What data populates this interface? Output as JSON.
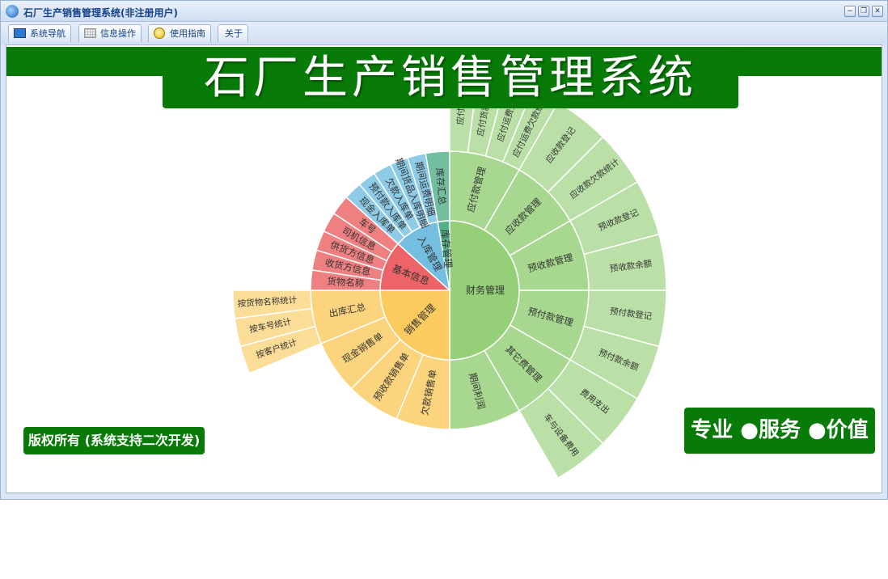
{
  "window": {
    "title": "石厂生产销售管理系统(非注册用户)",
    "controls": {
      "minimize": "−",
      "restore": "❐",
      "close": "✕"
    }
  },
  "menu": {
    "tabs": [
      {
        "label": "系统导航",
        "icon": "monitor-icon"
      },
      {
        "label": "信息操作",
        "icon": "grid-icon"
      },
      {
        "label": "使用指南",
        "icon": "bulb-icon"
      },
      {
        "label": "关于",
        "icon": ""
      }
    ]
  },
  "banner": {
    "title": "石厂生产销售管理系统"
  },
  "footer": {
    "copyright": "版权所有 (系统支持二次开发)",
    "slogan": "专业 ●服务 ●价值"
  },
  "colors": {
    "brand_green": "#077a07",
    "finance": "#95cf78",
    "sales": "#fbcb60",
    "basic": "#ec6467",
    "inbound": "#74bfe1",
    "stock": "#54b08a"
  },
  "chart_data": {
    "type": "sunburst",
    "groups": [
      {
        "name": "财务管理",
        "color": "#95cf78",
        "children": [
          {
            "name": "应付款管理",
            "children": [
              "应付货款",
              "应付货款欠款",
              "应付运费登记",
              "应付运费欠款统计"
            ]
          },
          {
            "name": "应收款管理",
            "children": [
              "应收款登记",
              "应收款欠款统计"
            ]
          },
          {
            "name": "预收款管理",
            "children": [
              "预收款登记",
              "预收款余额"
            ]
          },
          {
            "name": "预付款管理",
            "children": [
              "预付款登记",
              "预付款余额"
            ]
          },
          {
            "name": "其它费管理",
            "children": [
              "费用支出",
              "车与设备费用"
            ]
          },
          {
            "name": "期间利润",
            "children": []
          }
        ]
      },
      {
        "name": "销售管理",
        "color": "#fbcb60",
        "children": [
          {
            "name": "欠款销售单",
            "children": []
          },
          {
            "name": "预收款销售单",
            "children": []
          },
          {
            "name": "现金销售单",
            "children": []
          },
          {
            "name": "出库汇总",
            "children": [
              "按客户统计",
              "按车号统计",
              "按货物名称统计"
            ]
          }
        ]
      },
      {
        "name": "基本信息",
        "color": "#ec6467",
        "children": [
          {
            "name": "货物名称",
            "children": []
          },
          {
            "name": "收货方信息",
            "children": []
          },
          {
            "name": "供货方信息",
            "children": []
          },
          {
            "name": "司机信息",
            "children": []
          },
          {
            "name": "车号",
            "children": []
          }
        ]
      },
      {
        "name": "入库管理",
        "color": "#74bfe1",
        "children": [
          {
            "name": "现金入库单",
            "children": []
          },
          {
            "name": "预付款入库单",
            "children": []
          },
          {
            "name": "欠款入库单",
            "children": []
          },
          {
            "name": "期间货品入库明细",
            "children": []
          },
          {
            "name": "期间运费明细",
            "children": []
          }
        ]
      },
      {
        "name": "库存管理",
        "color": "#54b08a",
        "children": [
          {
            "name": "库存汇总",
            "children": []
          }
        ]
      }
    ]
  }
}
